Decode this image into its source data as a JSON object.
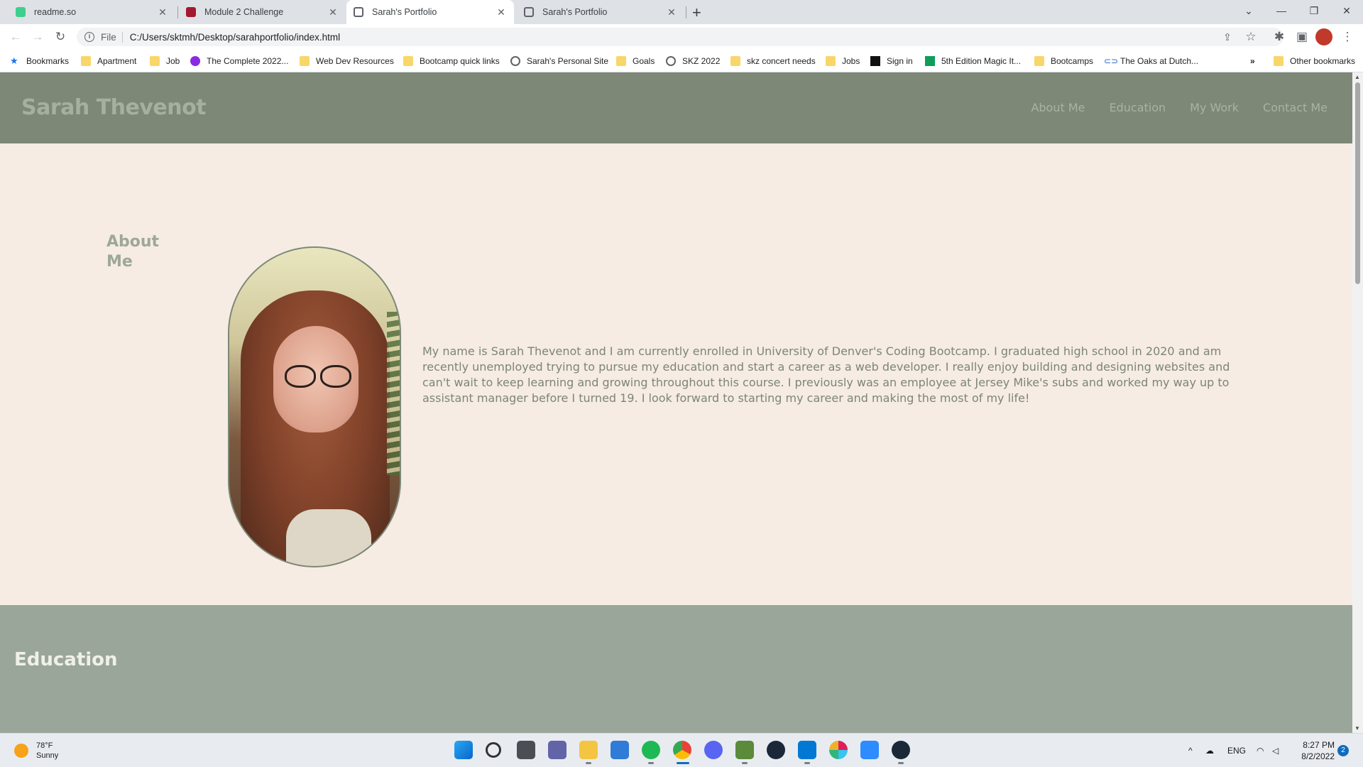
{
  "browser": {
    "tabs": [
      {
        "title": "readme.so",
        "active": false
      },
      {
        "title": "Module 2 Challenge",
        "active": false
      },
      {
        "title": "Sarah's Portfolio",
        "active": true
      },
      {
        "title": "Sarah's Portfolio",
        "active": false
      }
    ],
    "close_glyph": "✕",
    "newtab_glyph": "+",
    "address": {
      "scheme": "File",
      "url": "C:/Users/sktmh/Desktop/sarahportfolio/index.html"
    },
    "bookmarks": [
      {
        "label": "Bookmarks",
        "icon": "star-icon"
      },
      {
        "label": "Apartment",
        "icon": "folder-icon"
      },
      {
        "label": "Job",
        "icon": "folder-icon"
      },
      {
        "label": "The Complete 2022...",
        "icon": "course-icon"
      },
      {
        "label": "Web Dev Resources",
        "icon": "folder-icon"
      },
      {
        "label": "Bootcamp quick links",
        "icon": "folder-icon"
      },
      {
        "label": "Sarah's Personal Site",
        "icon": "globe-icon"
      },
      {
        "label": "Goals",
        "icon": "folder-icon"
      },
      {
        "label": "SKZ 2022",
        "icon": "globe-icon"
      },
      {
        "label": "skz concert needs",
        "icon": "folder-icon"
      },
      {
        "label": "Jobs",
        "icon": "folder-icon"
      },
      {
        "label": "Sign in",
        "icon": "site-icon"
      },
      {
        "label": "5th Edition Magic It...",
        "icon": "sheets-icon"
      },
      {
        "label": "Bootcamps",
        "icon": "folder-icon"
      },
      {
        "label": "The Oaks at Dutch...",
        "icon": "link-icon"
      }
    ],
    "overflow_label": "»",
    "other_bookmarks": "Other bookmarks"
  },
  "site": {
    "title": "Sarah Thevenot",
    "nav": [
      "About Me",
      "Education",
      "My Work",
      "Contact Me"
    ],
    "about": {
      "heading": "About Me",
      "text": "My name is Sarah Thevenot and I am currently enrolled in University of Denver's Coding Bootcamp. I graduated high school in 2020 and am recently unemployed trying to pursue my education and start a career as a web developer. I really enjoy building and designing websites and can't wait to keep learning and growing throughout this course. I previously was an employee at Jersey Mike's subs and worked my way up to assistant manager before I turned 19. I look forward to starting my career and making the most of my life!"
    },
    "education": {
      "heading": "Education"
    }
  },
  "taskbar": {
    "weather": {
      "temp": "78°F",
      "condition": "Sunny"
    },
    "tray_lang": "ENG",
    "time": "8:27 PM",
    "date": "8/2/2022",
    "notifications": "2"
  },
  "colors": {
    "header_bg": "#7d8877",
    "page_bg": "#f6ece3",
    "education_bg": "#9aa69a",
    "text": "#7c8577"
  }
}
